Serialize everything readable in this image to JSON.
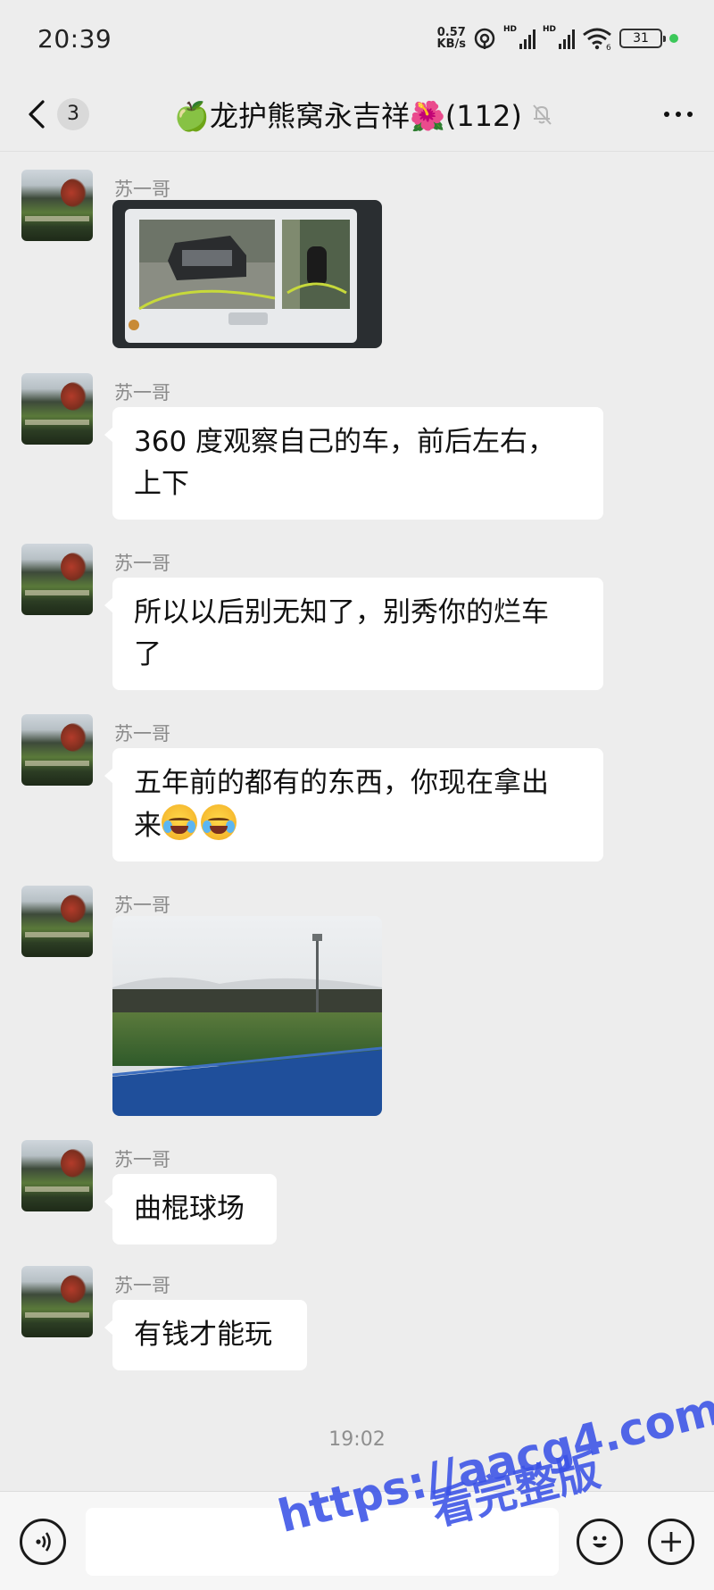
{
  "status_bar": {
    "time": "20:39",
    "net_speed_value": "0.57",
    "net_speed_unit": "KB/s",
    "sim1_tag": "HD",
    "sim2_tag": "HD",
    "wifi_tag": "6",
    "battery": "31",
    "icons": [
      "hotspot-icon",
      "signal-icon",
      "wifi-icon",
      "battery-icon"
    ]
  },
  "header": {
    "unread_count": "3",
    "title": "🍏龙护熊窝永吉祥🌺(112)",
    "icons": [
      "back-arrow-icon",
      "mute-bell-icon",
      "more-icon"
    ]
  },
  "messages": [
    {
      "sender": "苏一哥",
      "type": "image",
      "image": "car-360-camera-screen"
    },
    {
      "sender": "苏一哥",
      "type": "text",
      "lines": [
        "360 度观察自己的车，前后左右，",
        "上下"
      ]
    },
    {
      "sender": "苏一哥",
      "type": "text",
      "lines": [
        "所以以后别无知了，别秀你的烂车",
        "了"
      ]
    },
    {
      "sender": "苏一哥",
      "type": "text",
      "lines": [
        "五年前的都有的东西，你现在拿出",
        "来"
      ],
      "emoji": [
        "loudly-crying-face",
        "loudly-crying-face"
      ]
    },
    {
      "sender": "苏一哥",
      "type": "image",
      "image": "hockey-field-photo"
    },
    {
      "sender": "苏一哥",
      "type": "text",
      "lines": [
        "曲棍球场"
      ]
    },
    {
      "sender": "苏一哥",
      "type": "text",
      "lines": [
        "有钱才能玩"
      ]
    }
  ],
  "timestamp": "19:02",
  "input_bar": {
    "icons": [
      "voice-icon",
      "emoji-icon",
      "plus-icon"
    ],
    "text_value": ""
  },
  "watermark": {
    "line1": "https://aacg4.com",
    "line2": "看完整版",
    "color": "#3a52e6"
  }
}
